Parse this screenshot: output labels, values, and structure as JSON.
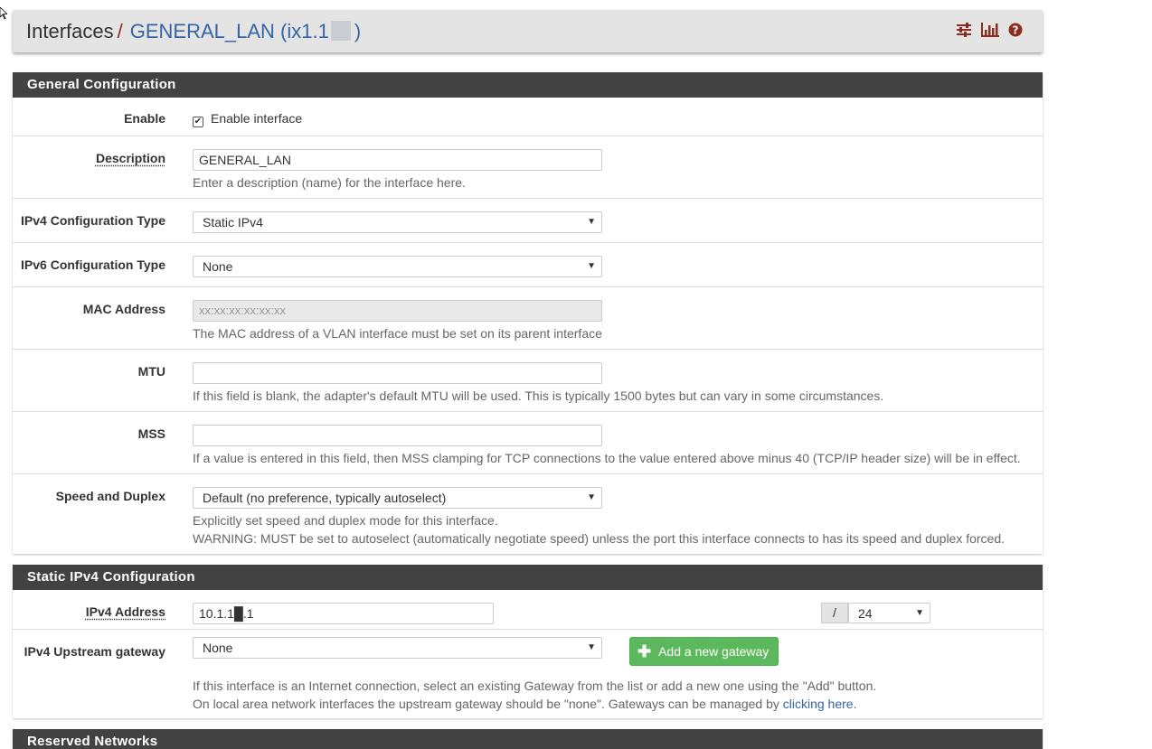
{
  "breadcrumb": {
    "root": "Interfaces",
    "separator": "/",
    "current_prefix": "GENERAL_LAN (ix1.1",
    "current_suffix": ")",
    "icons": [
      "sliders-icon",
      "bar-chart-icon",
      "help-icon"
    ]
  },
  "general": {
    "heading": "General Configuration",
    "enable": {
      "label": "Enable",
      "checkbox_label": "Enable interface",
      "checked": true
    },
    "description": {
      "label": "Description",
      "value": "GENERAL_LAN",
      "help": "Enter a description (name) for the interface here."
    },
    "ipv4_type": {
      "label": "IPv4 Configuration Type",
      "value": "Static IPv4"
    },
    "ipv6_type": {
      "label": "IPv6 Configuration Type",
      "value": "None"
    },
    "mac": {
      "label": "MAC Address",
      "placeholder": "xx:xx:xx:xx:xx:xx",
      "help": "The MAC address of a VLAN interface must be set on its parent interface"
    },
    "mtu": {
      "label": "MTU",
      "value": "",
      "help": "If this field is blank, the adapter's default MTU will be used. This is typically 1500 bytes but can vary in some circumstances."
    },
    "mss": {
      "label": "MSS",
      "value": "",
      "help": "If a value is entered in this field, then MSS clamping for TCP connections to the value entered above minus 40 (TCP/IP header size) will be in effect."
    },
    "speed": {
      "label": "Speed and Duplex",
      "value": "Default (no preference, typically autoselect)",
      "help1": "Explicitly set speed and duplex mode for this interface.",
      "help2": "WARNING: MUST be set to autoselect (automatically negotiate speed) unless the port this interface connects to has its speed and duplex forced."
    }
  },
  "static_ipv4": {
    "heading": "Static IPv4 Configuration",
    "address": {
      "label": "IPv4 Address",
      "value": "10.1.1█.1",
      "slash": "/",
      "prefix": "24"
    },
    "gateway": {
      "label": "IPv4 Upstream gateway",
      "value": "None",
      "add_button": "Add a new gateway",
      "help1": "If this interface is an Internet connection, select an existing Gateway from the list or add a new one using the \"Add\" button.",
      "help2_prefix": "On local area network interfaces the upstream gateway should be \"none\". Gateways can be managed by ",
      "help2_link": "clicking here",
      "help2_suffix": "."
    }
  },
  "reserved": {
    "heading": "Reserved Networks"
  },
  "colors": {
    "accent": "#3465a4",
    "heading_bg": "#424242",
    "icon_red": "#8b2c1e",
    "button_green": "#5cb85c"
  }
}
